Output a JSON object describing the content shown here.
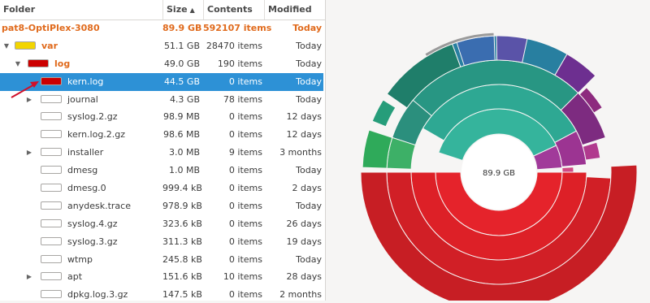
{
  "columns": {
    "folder": "Folder",
    "size": "Size",
    "contents": "Contents",
    "modified": "Modified"
  },
  "sort_indicator": "▲",
  "rows": [
    {
      "name": "pat8-OptiPlex-3080",
      "size": "89.9 GB",
      "contents": "592107 items",
      "modified": "Today",
      "depth": 0,
      "expander": "none",
      "swatch": null,
      "style": "root"
    },
    {
      "name": "var",
      "size": "51.1 GB",
      "contents": "28470 items",
      "modified": "Today",
      "depth": 1,
      "expander": "open",
      "swatch": "#f2d500",
      "style": "orange"
    },
    {
      "name": "log",
      "size": "49.0 GB",
      "contents": "190 items",
      "modified": "Today",
      "depth": 2,
      "expander": "open",
      "swatch": "#cc0000",
      "style": "orange"
    },
    {
      "name": "kern.log",
      "size": "44.5 GB",
      "contents": "0 items",
      "modified": "Today",
      "depth": 3,
      "expander": "none",
      "swatch": "#cc0000",
      "style": "selected"
    },
    {
      "name": "journal",
      "size": "4.3 GB",
      "contents": "78 items",
      "modified": "Today",
      "depth": 3,
      "expander": "closed",
      "swatch": "#ffffff",
      "style": ""
    },
    {
      "name": "syslog.2.gz",
      "size": "98.9 MB",
      "contents": "0 items",
      "modified": "12 days",
      "depth": 3,
      "expander": "none",
      "swatch": "#ffffff",
      "style": ""
    },
    {
      "name": "kern.log.2.gz",
      "size": "98.6 MB",
      "contents": "0 items",
      "modified": "12 days",
      "depth": 3,
      "expander": "none",
      "swatch": "#ffffff",
      "style": ""
    },
    {
      "name": "installer",
      "size": "3.0 MB",
      "contents": "9 items",
      "modified": "3 months",
      "depth": 3,
      "expander": "closed",
      "swatch": "#ffffff",
      "style": ""
    },
    {
      "name": "dmesg",
      "size": "1.0 MB",
      "contents": "0 items",
      "modified": "Today",
      "depth": 3,
      "expander": "none",
      "swatch": "#ffffff",
      "style": ""
    },
    {
      "name": "dmesg.0",
      "size": "999.4 kB",
      "contents": "0 items",
      "modified": "2 days",
      "depth": 3,
      "expander": "none",
      "swatch": "#ffffff",
      "style": ""
    },
    {
      "name": "anydesk.trace",
      "size": "978.9 kB",
      "contents": "0 items",
      "modified": "Today",
      "depth": 3,
      "expander": "none",
      "swatch": "#ffffff",
      "style": ""
    },
    {
      "name": "syslog.4.gz",
      "size": "323.6 kB",
      "contents": "0 items",
      "modified": "26 days",
      "depth": 3,
      "expander": "none",
      "swatch": "#ffffff",
      "style": ""
    },
    {
      "name": "syslog.3.gz",
      "size": "311.3 kB",
      "contents": "0 items",
      "modified": "19 days",
      "depth": 3,
      "expander": "none",
      "swatch": "#ffffff",
      "style": ""
    },
    {
      "name": "wtmp",
      "size": "245.8 kB",
      "contents": "0 items",
      "modified": "Today",
      "depth": 3,
      "expander": "none",
      "swatch": "#ffffff",
      "style": ""
    },
    {
      "name": "apt",
      "size": "151.6 kB",
      "contents": "10 items",
      "modified": "28 days",
      "depth": 3,
      "expander": "closed",
      "swatch": "#ffffff",
      "style": ""
    },
    {
      "name": "dpkg.log.3.gz",
      "size": "147.5 kB",
      "contents": "0 items",
      "modified": "2 months",
      "depth": 3,
      "expander": "none",
      "swatch": "#ffffff",
      "style": ""
    }
  ],
  "chart": {
    "center_label": "89.9 GB"
  },
  "colors": {
    "selection": "#2d91d6",
    "accent_orange": "#e06a1c",
    "annotation_arrow": "#d0102a"
  }
}
